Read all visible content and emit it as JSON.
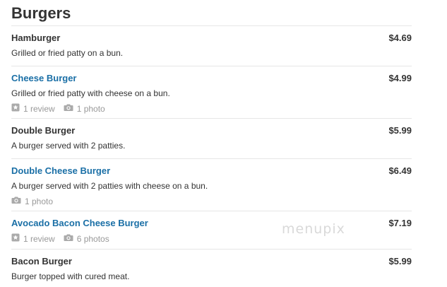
{
  "section": {
    "title": "Burgers"
  },
  "items": [
    {
      "name": "Hamburger",
      "price": "$4.69",
      "description": "Grilled or fried patty on a bun.",
      "review_text": "",
      "photo_text": ""
    },
    {
      "name": "Cheese Burger",
      "price": "$4.99",
      "description": "Grilled or fried patty with cheese on a bun.",
      "review_text": "1 review",
      "photo_text": "1 photo"
    },
    {
      "name": "Double Burger",
      "price": "$5.99",
      "description": "A burger served with 2 patties.",
      "review_text": "",
      "photo_text": ""
    },
    {
      "name": "Double Cheese Burger",
      "price": "$6.49",
      "description": "A burger served with 2 patties with cheese on a bun.",
      "review_text": "",
      "photo_text": "1 photo"
    },
    {
      "name": "Avocado Bacon Cheese Burger",
      "price": "$7.19",
      "description": "",
      "review_text": "1 review",
      "photo_text": "6 photos"
    },
    {
      "name": "Bacon Burger",
      "price": "$5.99",
      "description": "Burger topped with cured meat.",
      "review_text": "",
      "photo_text": ""
    }
  ],
  "icons": {
    "review": "review-star-icon",
    "photo": "camera-icon"
  },
  "colors": {
    "link": "#1a6fa6",
    "text": "#333333",
    "muted": "#999999",
    "divider": "#e6e6e6"
  },
  "watermark": "menupix"
}
